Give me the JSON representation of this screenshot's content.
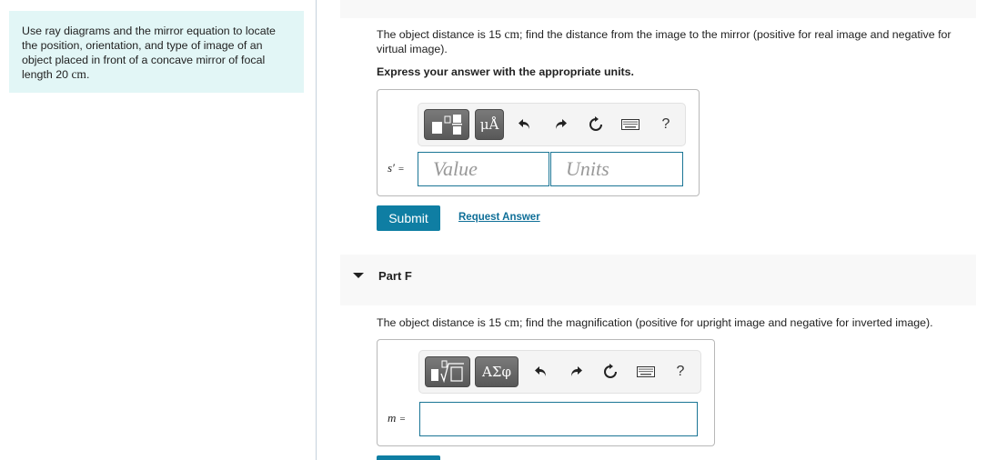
{
  "intro": {
    "text_before_unit": "Use ray diagrams and the mirror equation to locate the position, orientation, and type of image of an object placed in front of a concave mirror of focal length 20 ",
    "unit": "cm",
    "text_after_unit": "."
  },
  "part_e": {
    "question_before_unit": "The object distance is 15 ",
    "question_unit": "cm",
    "question_after_unit": "; find the distance from the image to the mirror (positive for real image and negative for virtual image).",
    "instruction": "Express your answer with the appropriate units.",
    "toolbar": {
      "template_button_icon": "fraction-template-icon",
      "units_button_label": "μÅ",
      "undo_icon": "undo-icon",
      "redo_icon": "redo-icon",
      "reset_icon": "reset-icon",
      "keyboard_icon": "keyboard-icon",
      "help_label": "?"
    },
    "variable_label": "s′",
    "equals": "=",
    "value_placeholder": "Value",
    "units_placeholder": "Units",
    "submit_label": "Submit",
    "request_answer_label": "Request Answer"
  },
  "part_f": {
    "title": "Part F",
    "question_before_unit": "The object distance is 15 ",
    "question_unit": "cm",
    "question_after_unit": "; find the magnification (positive for upright image and negative for inverted image).",
    "toolbar": {
      "template_button_icon": "radical-template-icon",
      "symbols_button_label": "ΑΣφ",
      "undo_icon": "undo-icon",
      "redo_icon": "redo-icon",
      "reset_icon": "reset-icon",
      "keyboard_icon": "keyboard-icon",
      "help_label": "?"
    },
    "variable_label": "m",
    "equals": "=",
    "answer_value": ""
  },
  "colors": {
    "accent": "#0f7ea3",
    "field_border": "#1a7595",
    "intro_background": "#e2f6f6",
    "part_header_background": "#f8f8f8"
  }
}
